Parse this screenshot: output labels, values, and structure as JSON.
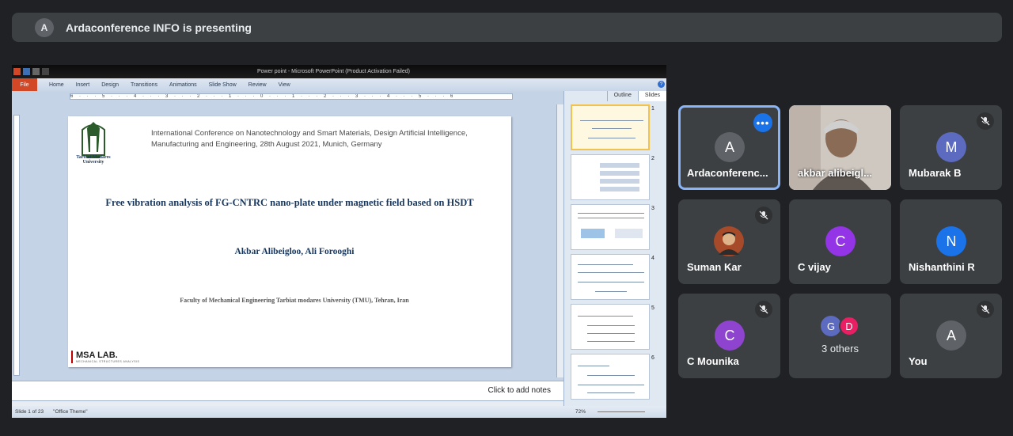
{
  "banner": {
    "avatar_letter": "A",
    "text": "Ardaconference INFO is presenting"
  },
  "powerpoint": {
    "window_title": "Power point - Microsoft PowerPoint (Product Activation Failed)",
    "ribbon_tabs": [
      "File",
      "Home",
      "Insert",
      "Design",
      "Transitions",
      "Animations",
      "Slide Show",
      "Review",
      "View"
    ],
    "ruler_text": "6 · · · 5 · · · 4 · · · 3 · · · 2 · · · 1 · · · 0 · · · 1 · · · 2 · · · 3 · · · 4 · · · 5 · · · 6",
    "slide": {
      "logo_text": "Tarbiat Modares University",
      "conference": "International Conference on Nanotechnology and Smart Materials, Design Artificial Intelligence, Manufacturing and Engineering, 28th August 2021, Munich, Germany",
      "title": "Free vibration analysis of FG-CNTRC nano-plate under magnetic field based on HSDT",
      "authors": "Akbar Alibeigloo,   Ali Forooghi",
      "faculty": "Faculty of Mechanical Engineering Tarbiat modares University (TMU), Tehran, Iran",
      "lab_name": "MSA LAB.",
      "lab_subtitle": "MECHANICAL STRUCTURES ANALYSIS"
    },
    "notes_placeholder": "Click to add notes",
    "panel_tabs": [
      "Outline",
      "Slides"
    ],
    "thumbnail_numbers": [
      "1",
      "2",
      "3",
      "4",
      "5",
      "6"
    ],
    "status_slide": "Slide 1 of 23",
    "status_theme": "\"Office Theme\"",
    "status_zoom": "72%"
  },
  "participants": [
    {
      "name": "Ardaconference INFO",
      "display": "Ardaconferenc...",
      "letter": "A",
      "color": "#5f6368",
      "muted": false,
      "active": true
    },
    {
      "name": "akbar alibeigloo",
      "display": "akbar alibeigl...",
      "letter": "",
      "color": "",
      "muted": false,
      "active": false
    },
    {
      "name": "Mubarak B",
      "display": "Mubarak B",
      "letter": "M",
      "color": "#5c6bc0",
      "muted": true,
      "active": false
    },
    {
      "name": "Suman Kar",
      "display": "Suman Kar",
      "letter": "",
      "color": "",
      "muted": true,
      "active": false
    },
    {
      "name": "C vijay",
      "display": "C vijay",
      "letter": "C",
      "color": "#9334e6",
      "muted": false,
      "active": false
    },
    {
      "name": "Nishanthini R",
      "display": "Nishanthini R",
      "letter": "N",
      "color": "#1a73e8",
      "muted": false,
      "active": false
    },
    {
      "name": "C Mounika",
      "display": "C Mounika",
      "letter": "C",
      "color": "#8e44ce",
      "muted": true,
      "active": false
    },
    {
      "name": "3 others",
      "display": "3 others",
      "letters": [
        "G",
        "D"
      ],
      "colors": [
        "#5c6bc0",
        "#e91e63"
      ],
      "muted": false,
      "active": false
    },
    {
      "name": "You",
      "display": "You",
      "letter": "A",
      "color": "#5f6368",
      "muted": true,
      "active": false
    }
  ],
  "colors": {
    "background": "#202124",
    "tile": "#3c4043",
    "active_border": "#8ab4f8",
    "more_button": "#1a73e8"
  }
}
